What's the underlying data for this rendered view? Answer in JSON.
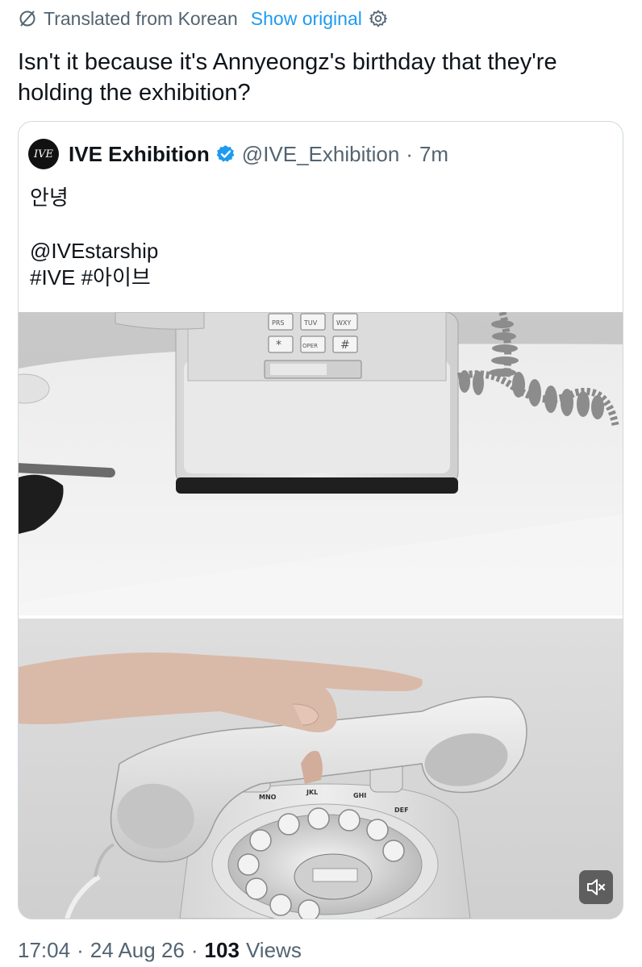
{
  "translation": {
    "label": "Translated from Korean",
    "show_original": "Show original"
  },
  "tweet": {
    "text": "Isn't it because it's Annyeongz's birthday that they're holding the exhibition?"
  },
  "quote": {
    "avatar_text": "IVE",
    "name": "IVE Exhibition",
    "handle": "@IVE_Exhibition",
    "separator": "·",
    "time": "7m",
    "lines": [
      "안녕",
      "",
      "@IVEstarship",
      "#IVE #아이브"
    ]
  },
  "media": {
    "keypad_labels": [
      "PRS",
      "TUV",
      "WXY",
      "*",
      "OPER",
      "#"
    ],
    "dial_letters": [
      "JKL",
      "GHI",
      "MNO",
      "DEF"
    ],
    "mute_icon": "speaker-muted-icon"
  },
  "meta": {
    "time": "17:04",
    "date": "24 Aug 26",
    "views_count": "103",
    "views_label": "Views",
    "dot": "·"
  },
  "colors": {
    "accent": "#1d9bf0",
    "muted": "#536471",
    "border": "#cfd9de"
  }
}
